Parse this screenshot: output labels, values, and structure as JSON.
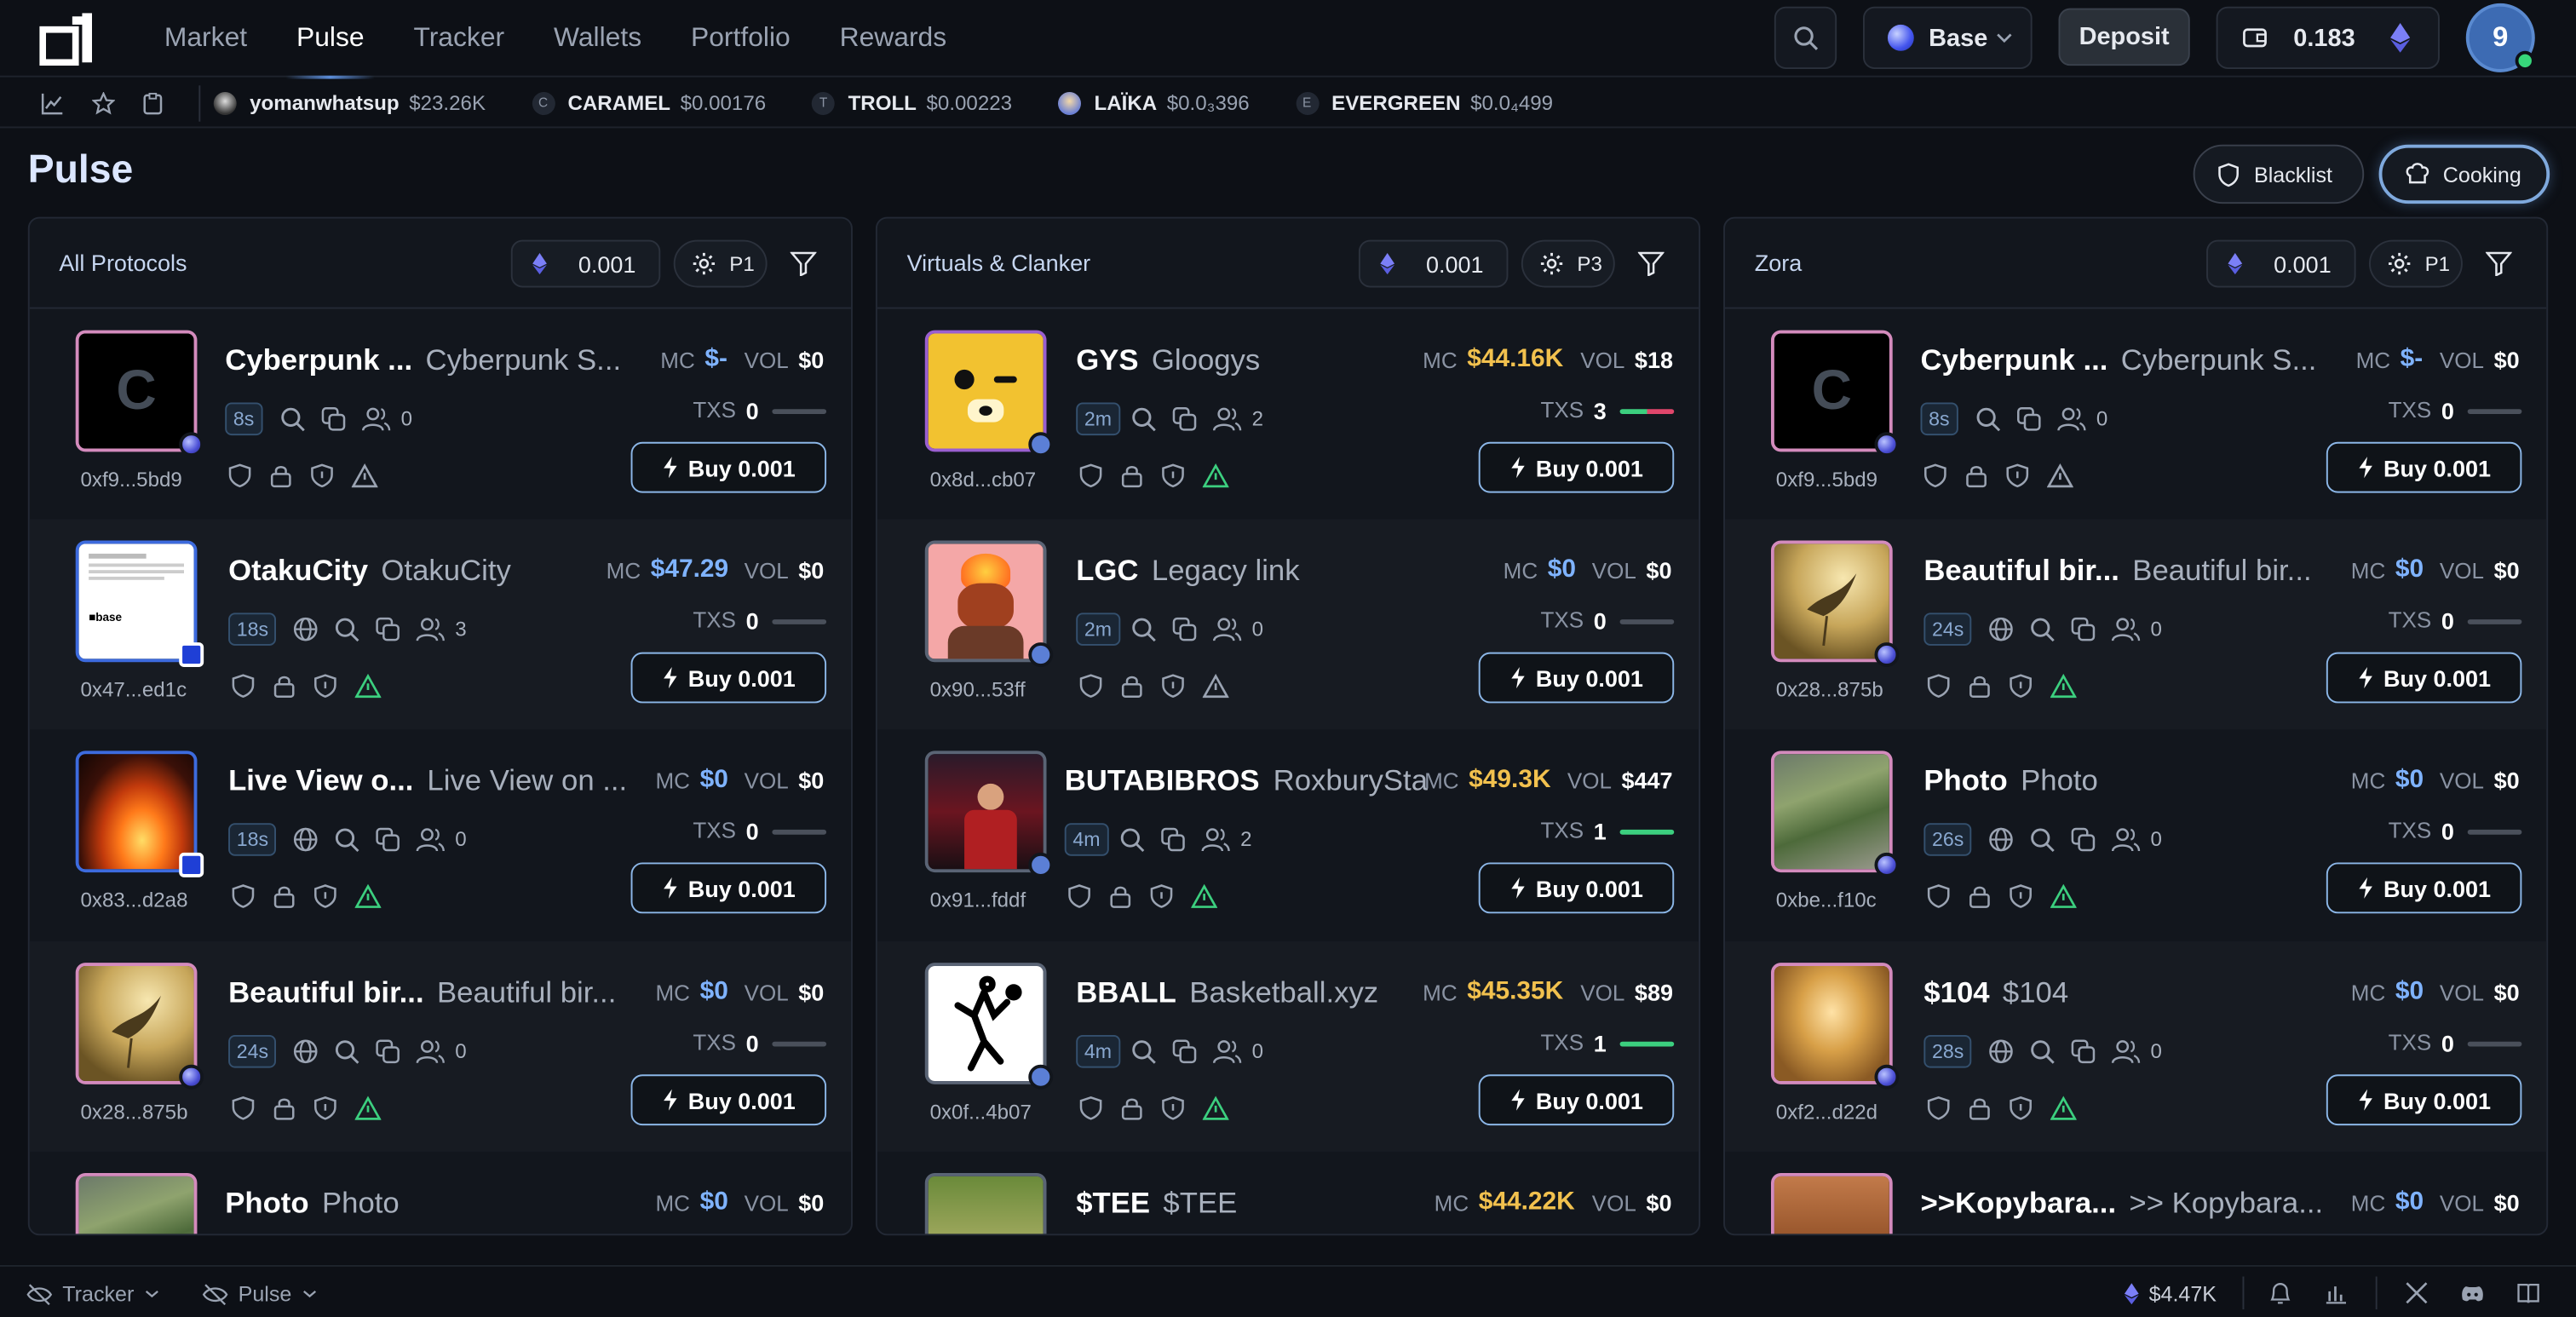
{
  "nav": {
    "links": [
      "Market",
      "Pulse",
      "Tracker",
      "Wallets",
      "Portfolio",
      "Rewards"
    ],
    "active": "Pulse"
  },
  "header": {
    "chain": "Base",
    "deposit": "Deposit",
    "balance": "0.183",
    "avatar_initial": "9"
  },
  "ticker": [
    {
      "icon": "",
      "name": "yomanwhatsup",
      "price": "$23.26K"
    },
    {
      "icon": "C",
      "name": "CARAMEL",
      "price": "$0.00176"
    },
    {
      "icon": "T",
      "name": "TROLL",
      "price": "$0.00223"
    },
    {
      "icon": "",
      "name": "LAÏKA",
      "price": "$0.0₃396"
    },
    {
      "icon": "E",
      "name": "EVERGREEN",
      "price": "$0.0₄499"
    }
  ],
  "page": {
    "title": "Pulse",
    "blacklist": "Blacklist",
    "cooking": "Cooking"
  },
  "columns": [
    {
      "title": "All Protocols",
      "amount": "0.001",
      "preset": "P1",
      "cards": [
        {
          "ticker": "Cyberpunk ...",
          "name": "Cyberpunk S...",
          "addr": "0xf9...5bd9",
          "age": "8s",
          "holders": "0",
          "mc": "$-",
          "vol": "$0",
          "txs": "0",
          "buy": "Buy 0.001",
          "mc_color": "#7fb3ff",
          "web": false,
          "avatar": "C"
        },
        {
          "ticker": "OtakuCity",
          "name": "OtakuCity",
          "addr": "0x47...ed1c",
          "age": "18s",
          "holders": "3",
          "mc": "$47.29",
          "vol": "$0",
          "txs": "0",
          "buy": "Buy 0.001",
          "mc_color": "#7fb3ff",
          "web": true,
          "avatar": "doc"
        },
        {
          "ticker": "Live View o...",
          "name": "Live View on ...",
          "addr": "0x83...d2a8",
          "age": "18s",
          "holders": "0",
          "mc": "$0",
          "vol": "$0",
          "txs": "0",
          "buy": "Buy 0.001",
          "mc_color": "#7fb3ff",
          "web": true,
          "avatar": "fire"
        },
        {
          "ticker": "Beautiful bir...",
          "name": "Beautiful bir...",
          "addr": "0x28...875b",
          "age": "24s",
          "holders": "0",
          "mc": "$0",
          "vol": "$0",
          "txs": "0",
          "buy": "Buy 0.001",
          "mc_color": "#7fb3ff",
          "web": true,
          "avatar": "bird"
        },
        {
          "ticker": "Photo",
          "name": "Photo",
          "addr": "",
          "age": "",
          "holders": "",
          "mc": "$0",
          "vol": "$0",
          "txs": "",
          "buy": "",
          "mc_color": "#7fb3ff",
          "web": false,
          "avatar": "photo"
        }
      ]
    },
    {
      "title": "Virtuals & Clanker",
      "amount": "0.001",
      "preset": "P3",
      "cards": [
        {
          "ticker": "GYS",
          "name": "Gloogys",
          "addr": "0x8d...cb07",
          "age": "2m",
          "holders": "2",
          "mc": "$44.16K",
          "vol": "$18",
          "txs": "3",
          "buy": "Buy 0.001",
          "mc_color": "#f2c14e",
          "web": false,
          "avatar": "dog"
        },
        {
          "ticker": "LGC",
          "name": "Legacy link",
          "addr": "0x90...53ff",
          "age": "2m",
          "holders": "0",
          "mc": "$0",
          "vol": "$0",
          "txs": "0",
          "buy": "Buy 0.001",
          "mc_color": "#7fb3ff",
          "web": false,
          "avatar": "fireman"
        },
        {
          "ticker": "BUTABIBROS",
          "name": "RoxburyStat...",
          "addr": "0x91...fddf",
          "age": "4m",
          "holders": "2",
          "mc": "$49.3K",
          "vol": "$447",
          "txs": "1",
          "buy": "Buy 0.001",
          "mc_color": "#f2c14e",
          "web": false,
          "avatar": "club"
        },
        {
          "ticker": "BBALL",
          "name": "Basketball.xyz",
          "addr": "0x0f...4b07",
          "age": "4m",
          "holders": "0",
          "mc": "$45.35K",
          "vol": "$89",
          "txs": "1",
          "buy": "Buy 0.001",
          "mc_color": "#f2c14e",
          "web": false,
          "avatar": "ball"
        },
        {
          "ticker": "$TEE",
          "name": "$TEE",
          "addr": "",
          "age": "",
          "holders": "",
          "mc": "$44.22K",
          "vol": "$0",
          "txs": "",
          "buy": "",
          "mc_color": "#f2c14e",
          "web": false,
          "avatar": "tee"
        }
      ]
    },
    {
      "title": "Zora",
      "amount": "0.001",
      "preset": "P1",
      "cards": [
        {
          "ticker": "Cyberpunk ...",
          "name": "Cyberpunk S...",
          "addr": "0xf9...5bd9",
          "age": "8s",
          "holders": "0",
          "mc": "$-",
          "vol": "$0",
          "txs": "0",
          "buy": "Buy 0.001",
          "mc_color": "#7fb3ff",
          "web": false,
          "avatar": "C"
        },
        {
          "ticker": "Beautiful bir...",
          "name": "Beautiful bir...",
          "addr": "0x28...875b",
          "age": "24s",
          "holders": "0",
          "mc": "$0",
          "vol": "$0",
          "txs": "0",
          "buy": "Buy 0.001",
          "mc_color": "#7fb3ff",
          "web": true,
          "avatar": "bird"
        },
        {
          "ticker": "Photo",
          "name": "Photo",
          "addr": "0xbe...f10c",
          "age": "26s",
          "holders": "0",
          "mc": "$0",
          "vol": "$0",
          "txs": "0",
          "buy": "Buy 0.001",
          "mc_color": "#7fb3ff",
          "web": true,
          "avatar": "photo"
        },
        {
          "ticker": "$104",
          "name": "$104",
          "addr": "0xf2...d22d",
          "age": "28s",
          "holders": "0",
          "mc": "$0",
          "vol": "$0",
          "txs": "0",
          "buy": "Buy 0.001",
          "mc_color": "#7fb3ff",
          "web": true,
          "avatar": "gold"
        },
        {
          "ticker": ">>Kopybara...",
          "name": ">> Kopybara...",
          "addr": "",
          "age": "",
          "holders": "",
          "mc": "$0",
          "vol": "$0",
          "txs": "",
          "buy": "",
          "mc_color": "#7fb3ff",
          "web": false,
          "avatar": "capy"
        }
      ]
    }
  ],
  "labels": {
    "mc": "MC",
    "vol": "VOL",
    "txs": "TXS"
  },
  "footer": {
    "tracker": "Tracker",
    "pulse": "Pulse",
    "eth_price": "$4.47K"
  }
}
